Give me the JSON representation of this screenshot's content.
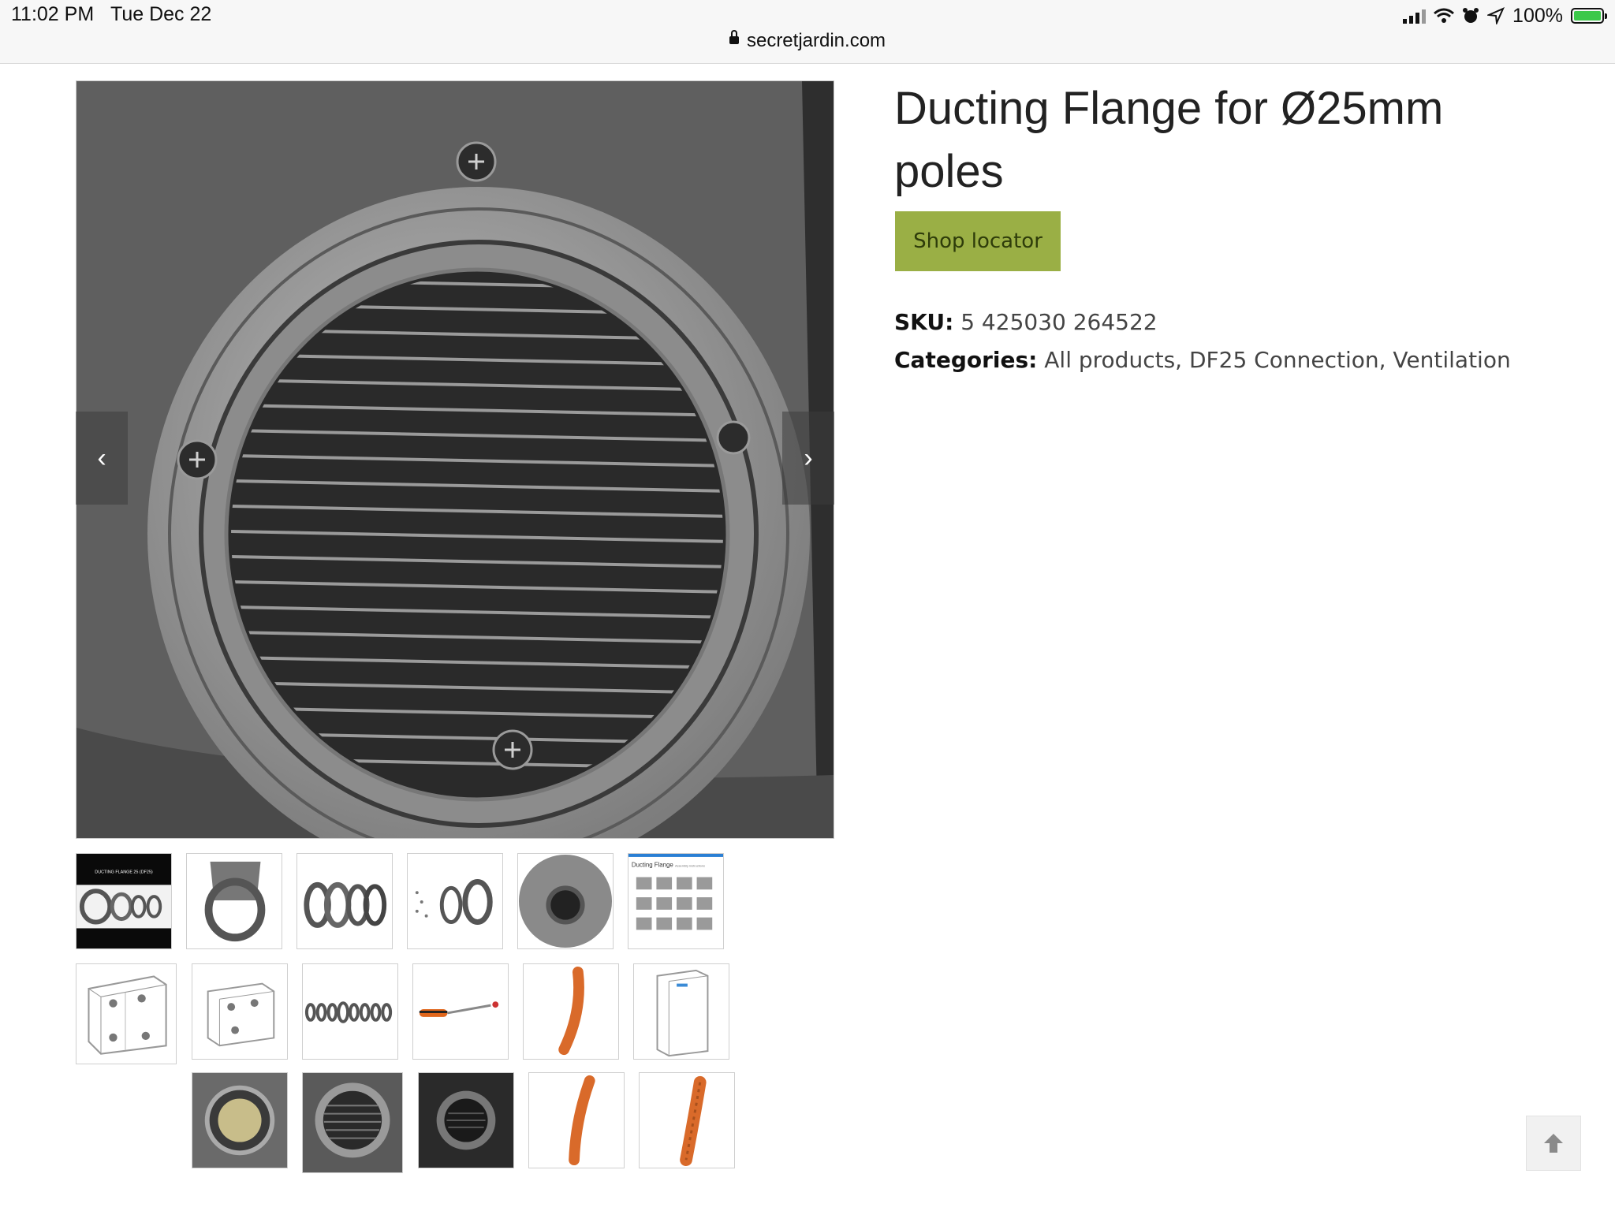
{
  "status_bar": {
    "time": "11:02 PM",
    "date": "Tue Dec 22",
    "battery": "100%",
    "battery_level": 1.0
  },
  "browser": {
    "url": "secretjardin.com"
  },
  "product": {
    "title": "Ducting Flange for Ø25mm poles",
    "shop_locator_label": "Shop locator",
    "sku_label": "SKU:",
    "sku_value": "5 425030 264522",
    "categories_label": "Categories:",
    "categories": [
      "All products",
      "DF25 Connection",
      "Ventilation"
    ],
    "category_separator": ", "
  },
  "gallery": {
    "prev_label": "‹",
    "next_label": "›",
    "thumbnail_1_text": "DUCTING FLANGE 25 (DF25)",
    "thumbnail_6_text": "Ducting Flange",
    "thumbnail_6_subtext": "Assembly instructions"
  },
  "icons": {
    "prev": "chevron-left-icon",
    "next": "chevron-right-icon",
    "scroll_top": "arrow-up-icon",
    "lock": "lock-icon"
  },
  "colors": {
    "accent": "#9aaf45",
    "button_text": "#2e3c0a",
    "text": "#222222"
  }
}
